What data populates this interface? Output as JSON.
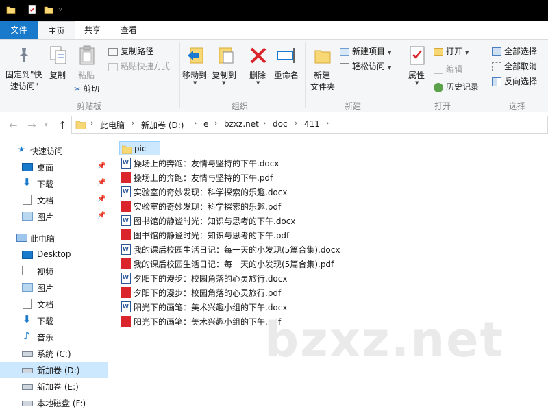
{
  "tabs": [
    {
      "label": "文件"
    },
    {
      "label": "主页"
    },
    {
      "label": "共享"
    },
    {
      "label": "查看"
    }
  ],
  "ribbon": {
    "clipboard": {
      "pin_label_1": "固定到\"快",
      "pin_label_2": "速访问\"",
      "copy": "复制",
      "paste": "粘贴",
      "copy_path": "复制路径",
      "paste_shortcut": "粘贴快捷方式",
      "cut": "剪切",
      "group": "剪贴板"
    },
    "organize": {
      "move_to": "移动到",
      "copy_to": "复制到",
      "delete": "删除",
      "rename": "重命名",
      "group": "组织"
    },
    "new": {
      "new_folder_1": "新建",
      "new_folder_2": "文件夹",
      "new_item": "新建项目",
      "easy_access": "轻松访问",
      "group": "新建"
    },
    "open": {
      "properties": "属性",
      "open": "打开",
      "edit": "编辑",
      "history": "历史记录",
      "group": "打开"
    },
    "select": {
      "select_all": "全部选择",
      "select_none": "全部取消",
      "invert": "反向选择",
      "group": "选择"
    }
  },
  "address": {
    "crumbs": [
      "此电脑",
      "新加卷 (D:)",
      "e",
      "bzxz.net",
      "doc",
      "411"
    ]
  },
  "sidebar": {
    "items": [
      {
        "label": "快速访问",
        "icon": "star-icon"
      },
      {
        "label": "桌面",
        "icon": "desktop-icon"
      },
      {
        "label": "下载",
        "icon": "download-icon"
      },
      {
        "label": "文档",
        "icon": "document-icon"
      },
      {
        "label": "图片",
        "icon": "picture-icon"
      },
      {
        "label": "此电脑",
        "icon": "computer-icon"
      },
      {
        "label": "Desktop",
        "icon": "desktop-icon"
      },
      {
        "label": "视频",
        "icon": "video-icon"
      },
      {
        "label": "图片",
        "icon": "picture-icon"
      },
      {
        "label": "文档",
        "icon": "document-icon"
      },
      {
        "label": "下载",
        "icon": "download-icon"
      },
      {
        "label": "音乐",
        "icon": "music-icon"
      },
      {
        "label": "系统 (C:)",
        "icon": "drive-icon"
      },
      {
        "label": "新加卷 (D:)",
        "icon": "drive-icon"
      },
      {
        "label": "新加卷 (E:)",
        "icon": "drive-icon"
      },
      {
        "label": "本地磁盘 (F:)",
        "icon": "drive-icon"
      }
    ]
  },
  "files": [
    {
      "name": "pic",
      "type": "folder"
    },
    {
      "name": "操场上的奔跑：友情与坚持的下午.docx",
      "type": "docx"
    },
    {
      "name": "操场上的奔跑：友情与坚持的下午.pdf",
      "type": "pdf"
    },
    {
      "name": "实验室的奇妙发现：科学探索的乐趣.docx",
      "type": "docx"
    },
    {
      "name": "实验室的奇妙发现：科学探索的乐趣.pdf",
      "type": "pdf"
    },
    {
      "name": "图书馆的静谧时光：知识与思考的下午.docx",
      "type": "docx"
    },
    {
      "name": "图书馆的静谧时光：知识与思考的下午.pdf",
      "type": "pdf"
    },
    {
      "name": "我的课后校园生活日记：每一天的小发现(5篇合集).docx",
      "type": "docx"
    },
    {
      "name": "我的课后校园生活日记：每一天的小发现(5篇合集).pdf",
      "type": "pdf"
    },
    {
      "name": "夕阳下的漫步：校园角落的心灵旅行.docx",
      "type": "docx"
    },
    {
      "name": "夕阳下的漫步：校园角落的心灵旅行.pdf",
      "type": "pdf"
    },
    {
      "name": "阳光下的画笔：美术兴趣小组的下午.docx",
      "type": "docx"
    },
    {
      "name": "阳光下的画笔：美术兴趣小组的下午.pdf",
      "type": "pdf"
    }
  ],
  "watermark": "bzxz.net",
  "colors": {
    "accent": "#1979ca",
    "selection": "#cce8ff",
    "folder": "#f8d775",
    "word": "#2b579a",
    "pdf": "#d9252b"
  }
}
